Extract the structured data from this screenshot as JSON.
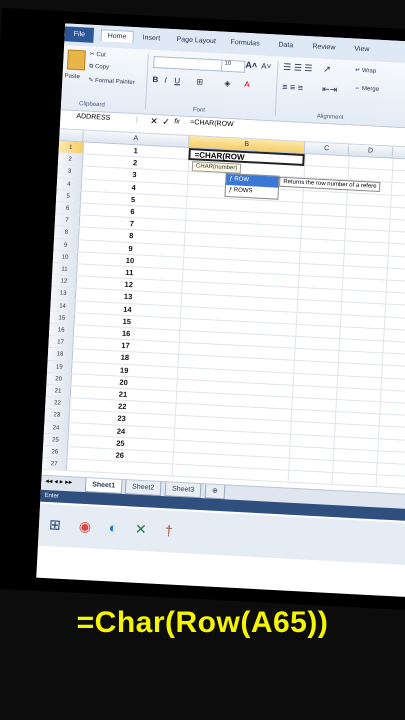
{
  "ribbon": {
    "tabs": [
      "File",
      "Home",
      "Insert",
      "Page Layout",
      "Formulas",
      "Data",
      "Review",
      "View"
    ],
    "clipboard": {
      "paste": "Paste",
      "cut": "Cut",
      "copy": "Copy",
      "format_painter": "Format Painter",
      "label": "Clipboard"
    },
    "font": {
      "size": "10",
      "label": "Font",
      "bold": "B",
      "italic": "I",
      "underline": "U"
    },
    "alignment": {
      "wrap": "Wrap",
      "merge": "Merge",
      "label": "Alignment"
    }
  },
  "formula_bar": {
    "name_box": "ADDRESS",
    "fx": "fx",
    "content": "=CHAR(ROW"
  },
  "columns": [
    "A",
    "B",
    "C",
    "D",
    "E"
  ],
  "rows": [
    {
      "n": "1",
      "a": "1"
    },
    {
      "n": "2",
      "a": "2"
    },
    {
      "n": "3",
      "a": "3"
    },
    {
      "n": "4",
      "a": "4"
    },
    {
      "n": "5",
      "a": "5"
    },
    {
      "n": "6",
      "a": "6"
    },
    {
      "n": "7",
      "a": "7"
    },
    {
      "n": "8",
      "a": "8"
    },
    {
      "n": "9",
      "a": "9"
    },
    {
      "n": "10",
      "a": "10"
    },
    {
      "n": "11",
      "a": "11"
    },
    {
      "n": "12",
      "a": "12"
    },
    {
      "n": "13",
      "a": "13"
    },
    {
      "n": "14",
      "a": "14"
    },
    {
      "n": "15",
      "a": "15"
    },
    {
      "n": "16",
      "a": "16"
    },
    {
      "n": "17",
      "a": "17"
    },
    {
      "n": "18",
      "a": "18"
    },
    {
      "n": "19",
      "a": "19"
    },
    {
      "n": "20",
      "a": "20"
    },
    {
      "n": "21",
      "a": "21"
    },
    {
      "n": "22",
      "a": "22"
    },
    {
      "n": "23",
      "a": "23"
    },
    {
      "n": "24",
      "a": "24"
    },
    {
      "n": "25",
      "a": "25"
    },
    {
      "n": "26",
      "a": "26"
    },
    {
      "n": "27",
      "a": ""
    }
  ],
  "active_cell": {
    "content": "=CHAR(ROW"
  },
  "tooltip": "CHAR(number)",
  "autocomplete": {
    "items": [
      "ROW",
      "ROWS"
    ],
    "description": "Returns the row number of a refere"
  },
  "sheets": [
    "Sheet1",
    "Sheet2",
    "Sheet3"
  ],
  "status": "Enter",
  "caption": "=Char(Row(A65))"
}
